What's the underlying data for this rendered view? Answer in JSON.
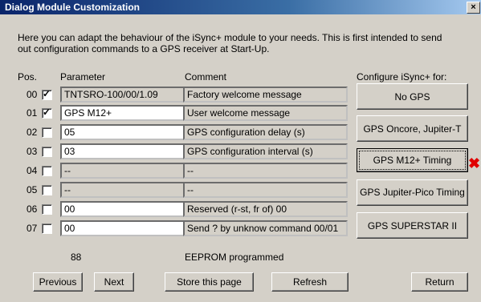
{
  "title": "Dialog Module Customization",
  "close_label": "×",
  "intro": "Here you can adapt the behaviour of the iSync+ module to your needs. This is first intended to send out configuration commands to a GPS receiver at Start-Up.",
  "headers": {
    "pos": "Pos.",
    "parameter": "Parameter",
    "comment": "Comment",
    "configure": "Configure iSync+ for:"
  },
  "rows": [
    {
      "pos": "00",
      "checked": true,
      "value": "TNTSRO-100/00/1.09",
      "editable": false,
      "comment": "Factory welcome message"
    },
    {
      "pos": "01",
      "checked": true,
      "value": "GPS M12+",
      "editable": true,
      "comment": "User welcome message"
    },
    {
      "pos": "02",
      "checked": false,
      "value": "05",
      "editable": true,
      "comment": "GPS configuration delay (s)"
    },
    {
      "pos": "03",
      "checked": false,
      "value": "03",
      "editable": true,
      "comment": "GPS configuration interval (s)"
    },
    {
      "pos": "04",
      "checked": false,
      "value": "--",
      "editable": false,
      "comment": "--"
    },
    {
      "pos": "05",
      "checked": false,
      "value": "--",
      "editable": false,
      "comment": "--"
    },
    {
      "pos": "06",
      "checked": false,
      "value": "00",
      "editable": true,
      "comment": "Reserved (r-st, fr of) 00"
    },
    {
      "pos": "07",
      "checked": false,
      "value": "00",
      "editable": true,
      "comment": "Send ? by unknow command 00/01"
    }
  ],
  "config_buttons": [
    "No GPS",
    "GPS Oncore, Jupiter-T",
    "GPS M12+ Timing",
    "GPS Jupiter-Pico Timing",
    "GPS SUPERSTAR II"
  ],
  "status_count": "88",
  "status_text": "EEPROM programmed",
  "buttons": {
    "previous": "Previous",
    "next": "Next",
    "store": "Store this page",
    "refresh": "Refresh",
    "return": "Return"
  },
  "marker": "✖"
}
